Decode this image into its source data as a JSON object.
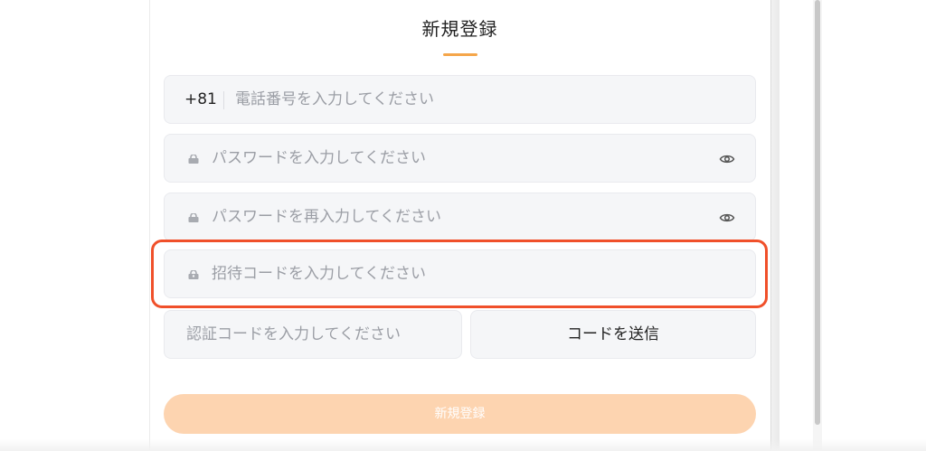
{
  "form": {
    "title": "新規登録",
    "phone": {
      "country_code": "+81",
      "placeholder": "電話番号を入力してください"
    },
    "password": {
      "placeholder": "パスワードを入力してください"
    },
    "password_confirm": {
      "placeholder": "パスワードを再入力してください"
    },
    "invite_code": {
      "placeholder": "招待コードを入力してください"
    },
    "verify_code": {
      "placeholder": "認証コードを入力してください"
    },
    "send_code_label": "コードを送信",
    "submit_label": "新規登録"
  },
  "colors": {
    "accent": "#f5a64a",
    "highlight": "#f0502a",
    "submit_disabled": "#fdd4b0",
    "field_bg": "#f5f6f8"
  },
  "icons": {
    "lock": "lock-icon",
    "eye": "eye-icon",
    "invite": "invite-icon"
  }
}
